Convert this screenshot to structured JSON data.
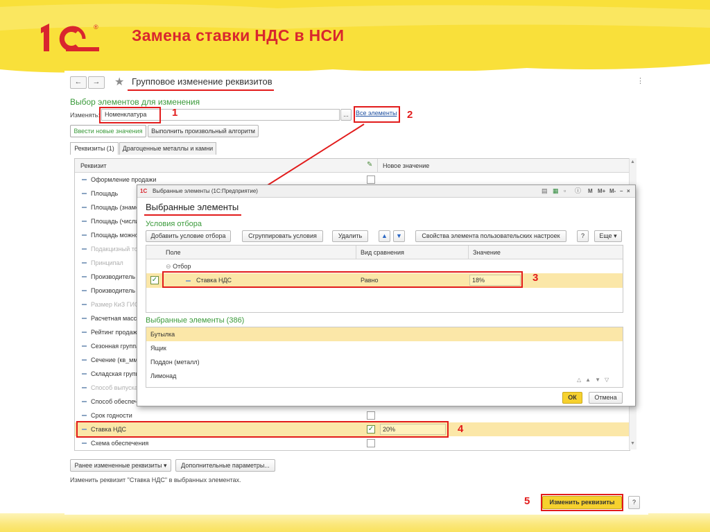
{
  "slide": {
    "title": "Замена ставки НДС в НСИ",
    "logo_text": "1С",
    "logo_registered": "®"
  },
  "colors": {
    "accent_red": "#e21b1b",
    "title_red": "#d9262e",
    "highlight_yellow": "#fbe7a8",
    "ok_yellow": "#f6d12e",
    "section_green": "#3a9a3a"
  },
  "form": {
    "back_icon": "arrow-left-icon",
    "forward_icon": "arrow-right-icon",
    "favorite_icon": "star-icon",
    "title": "Групповое изменение реквизитов",
    "more_icon": "dots-icon",
    "section_title": "Выбор элементов для изменения",
    "change_label": "Изменять:",
    "change_value": "Номенклатура",
    "select_button": "...",
    "all_elements_link": "Все элементы",
    "mode_buttons": [
      "Ввести новые значения",
      "Выполнить произвольный алгоритм"
    ],
    "tabs": [
      "Реквизиты (1)",
      "Драгоценные металлы и камни"
    ],
    "grid": {
      "col_attr": "Реквизит",
      "edit_icon": "pencil-icon",
      "col_new_value": "Новое значение",
      "rows": [
        {
          "name": "Оформление продажи",
          "disabled": false,
          "checked": false
        },
        {
          "name": "Площадь",
          "disabled": false,
          "checked": false
        },
        {
          "name": "Площадь (знаме",
          "disabled": false,
          "checked": false
        },
        {
          "name": "Площадь (числи",
          "disabled": false,
          "checked": false
        },
        {
          "name": "Площадь можно",
          "disabled": false,
          "checked": false
        },
        {
          "name": "Подакцизный то",
          "disabled": true,
          "checked": false
        },
        {
          "name": "Принципал",
          "disabled": true,
          "checked": false
        },
        {
          "name": "Производитель",
          "disabled": false,
          "checked": false
        },
        {
          "name": "Производитель",
          "disabled": false,
          "checked": false
        },
        {
          "name": "Размер КиЗ ГИС",
          "disabled": true,
          "checked": false
        },
        {
          "name": "Расчетная масс",
          "disabled": false,
          "checked": false
        },
        {
          "name": "Рейтинг продаж",
          "disabled": false,
          "checked": false
        },
        {
          "name": "Сезонная группа",
          "disabled": false,
          "checked": false
        },
        {
          "name": "Сечение (кв_мм",
          "disabled": false,
          "checked": false
        },
        {
          "name": "Складская групп",
          "disabled": false,
          "checked": false
        },
        {
          "name": "Способ выпуска",
          "disabled": true,
          "checked": false
        },
        {
          "name": "Способ обеспеч",
          "disabled": false,
          "checked": false
        },
        {
          "name": "Срок годности",
          "disabled": false,
          "checked": false,
          "show_chk": true
        },
        {
          "name": "Ставка НДС",
          "disabled": false,
          "checked": true,
          "value": "20%",
          "selected": true
        },
        {
          "name": "Схема обеспечения",
          "disabled": false,
          "checked": false,
          "show_chk": true
        }
      ]
    },
    "bottom_buttons": [
      "Ранее измененные реквизиты",
      "Дополнительные параметры..."
    ],
    "status_text": "Изменить реквизит \"Ставка НДС\" в выбранных элементах.",
    "apply_button": "Изменить реквизиты",
    "help_button": "?"
  },
  "modal": {
    "app_icon_text": "1С",
    "window_title": "Выбранные элементы  (1С:Предприятие)",
    "title_icons": [
      "doc-icon",
      "save-icon",
      "calendar-icon",
      "info-icon",
      "M",
      "M+",
      "M-",
      "minimize",
      "maximize",
      "close"
    ],
    "heading": "Выбранные элементы",
    "conditions_title": "Условия отбора",
    "toolbar": [
      "Добавить условие отбора",
      "Сгруппировать условия",
      "Удалить"
    ],
    "up_icon": "arrow-up-icon",
    "down_icon": "arrow-down-icon",
    "props_button": "Свойства элемента пользовательских настроек",
    "help_button": "?",
    "more_button": "Еще",
    "cols": [
      "Поле",
      "Вид сравнения",
      "Значение"
    ],
    "group_name": "Отбор",
    "condition": {
      "field": "Ставка НДС",
      "comparison": "Равно",
      "value": "18%"
    },
    "selected_title": "Выбранные элементы (386)",
    "items": [
      "Бутылка",
      "Ящик",
      "Поддон (металл)",
      "Лимонад"
    ],
    "ok_button": "ОК",
    "cancel_button": "Отмена"
  },
  "callouts": [
    "1",
    "2",
    "3",
    "4",
    "5"
  ]
}
